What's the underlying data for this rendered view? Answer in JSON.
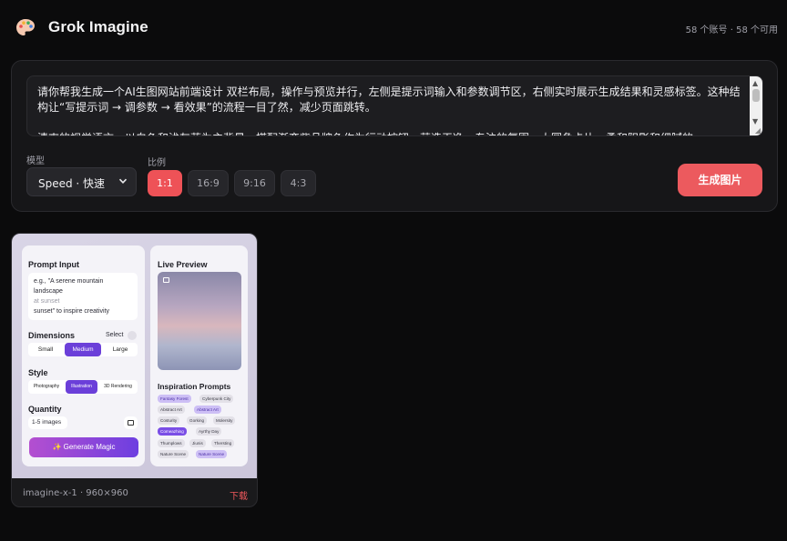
{
  "header": {
    "title": "Grok Imagine",
    "account_info": "58 个账号 · 58 个可用"
  },
  "prompt": {
    "text": "请你帮我生成一个AI生图网站前端设计 双栏布局，操作与预览并行，左侧是提示词输入和参数调节区，右侧实时展示生成结果和灵感标签。这种结构让“写提示词 → 调参数 → 看效果”的流程一目了然，减少页面跳转。\n\n清爽的视觉语言，以白色和浅灰蓝为主背景，搭配渐变紫品牌色作为行动按钮，营造干净、专注的氛围。大圆角卡片、柔和阴影和细腻的"
  },
  "model": {
    "label": "模型",
    "selected": "Speed · 快速"
  },
  "ratio": {
    "label": "比例",
    "options": [
      "1:1",
      "16:9",
      "9:16",
      "4:3"
    ],
    "selected": "1:1"
  },
  "generate_label": "生成图片",
  "results": [
    {
      "meta": "imagine-x-1 · 960×960",
      "download_label": "下载",
      "mockup": {
        "left": {
          "prompt_heading": "Prompt Input",
          "prompt_placeholder_1": "e.g., \"A serene mountain",
          "prompt_placeholder_2": "landscape",
          "prompt_placeholder_3": "at sunset",
          "prompt_placeholder_4": "sunset\" to inspire creativity",
          "dimensions_heading": "Dimensions",
          "dimensions_select": "Select",
          "dimensions": [
            "Small",
            "Medium",
            "Large"
          ],
          "style_heading": "Style",
          "styles": [
            "Photography",
            "Illustration",
            "3D Rendering"
          ],
          "quantity_heading": "Quantity",
          "quantity_value": "1-5 images",
          "generate_magic": "✨ Generate Magic"
        },
        "right": {
          "preview_heading": "Live Preview",
          "inspiration_heading": "Inspiration Prompts",
          "tags": [
            "Fantasy Forest",
            "Cyberpunk City",
            "Abstract Art",
            "Abstract Art",
            "Costurity",
            "Gorking",
            "Molersity",
            "Comeazhing",
            "Ayrthy Day",
            "Thumplows",
            "Jiunis",
            "Thersting",
            "Nature Scene",
            "Nature Scene"
          ]
        }
      }
    }
  ],
  "colors": {
    "accent": "#ec5a5e",
    "background": "#0b0b0c",
    "panel": "#161618",
    "brand_purple": "#6b3fd9"
  }
}
